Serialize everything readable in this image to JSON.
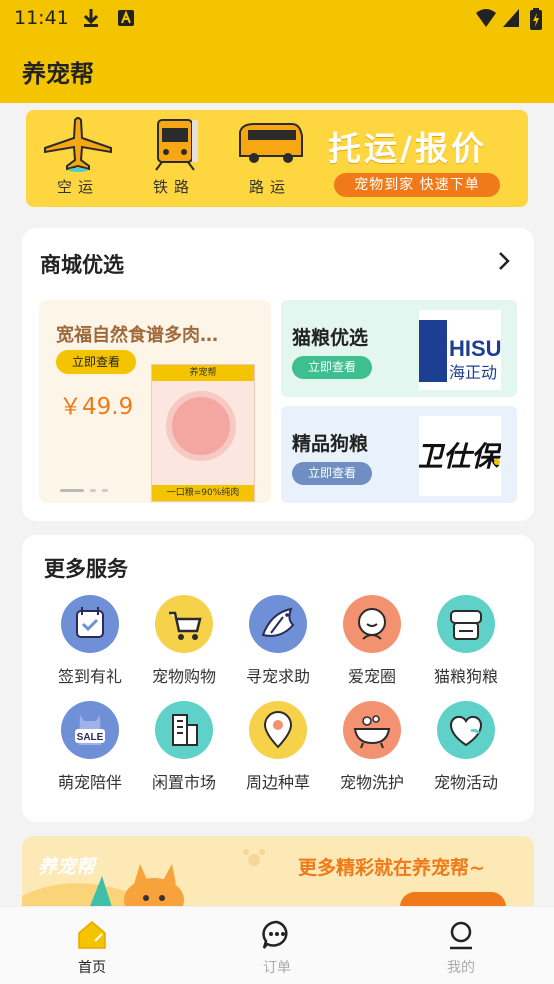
{
  "status_bar": {
    "time": "11:41"
  },
  "header": {
    "title": "养宠帮"
  },
  "banner": {
    "transports": [
      {
        "label": "空运",
        "icon": "airplane-icon"
      },
      {
        "label": "铁路",
        "icon": "train-icon"
      },
      {
        "label": "路运",
        "icon": "bus-icon"
      }
    ],
    "slogan": "托运/报价",
    "sub": "宠物到家 快速下单"
  },
  "mall": {
    "title": "商城优选",
    "promo": {
      "name": "宽福自然食谱多肉…",
      "button": "立即查看",
      "price": "￥49.9",
      "bag_brand": "养宠帮",
      "bag_tag": "一口粮=90%纯肉"
    },
    "tiles": [
      {
        "name": "猫粮优选",
        "button": "立即查看",
        "logo_text": "HISU 海正动",
        "bg": "#e3f6ef",
        "pill": "#3dbf8f"
      },
      {
        "name": "精品狗粮",
        "button": "立即查看",
        "logo_text": "卫仕保",
        "bg": "#e9f1fb",
        "pill": "#6f8fc2"
      }
    ]
  },
  "services": {
    "title": "更多服务",
    "items": [
      {
        "label": "签到有礼",
        "icon": "calendar-check-icon",
        "color": "#6f8fd6"
      },
      {
        "label": "宠物购物",
        "icon": "shopping-cart-icon",
        "color": "#f6d24a"
      },
      {
        "label": "寻宠求助",
        "icon": "bird-icon",
        "color": "#6f8fd6"
      },
      {
        "label": "爱宠圈",
        "icon": "pet-face-icon",
        "color": "#f39270"
      },
      {
        "label": "猫粮狗粮",
        "icon": "pet-food-icon",
        "color": "#5fd1c8"
      },
      {
        "label": "萌宠陪伴",
        "icon": "sale-bag-icon",
        "color": "#6f8fd6"
      },
      {
        "label": "闲置市场",
        "icon": "building-icon",
        "color": "#5fd1c8"
      },
      {
        "label": "周边种草",
        "icon": "location-pin-icon",
        "color": "#f6d24a"
      },
      {
        "label": "宠物洗护",
        "icon": "bathtub-icon",
        "color": "#f39270"
      },
      {
        "label": "宠物活动",
        "icon": "heart-icon",
        "color": "#5fd1c8"
      }
    ]
  },
  "bottom_banner": {
    "brand": "养宠帮",
    "text": "更多精彩就在养宠帮~"
  },
  "tabs": [
    {
      "label": "首页",
      "icon": "home-icon",
      "active": true
    },
    {
      "label": "订单",
      "icon": "chat-icon",
      "active": false
    },
    {
      "label": "我的",
      "icon": "profile-icon",
      "active": false
    }
  ],
  "colors": {
    "brand": "#f5c400",
    "accent": "#f07a1a"
  }
}
